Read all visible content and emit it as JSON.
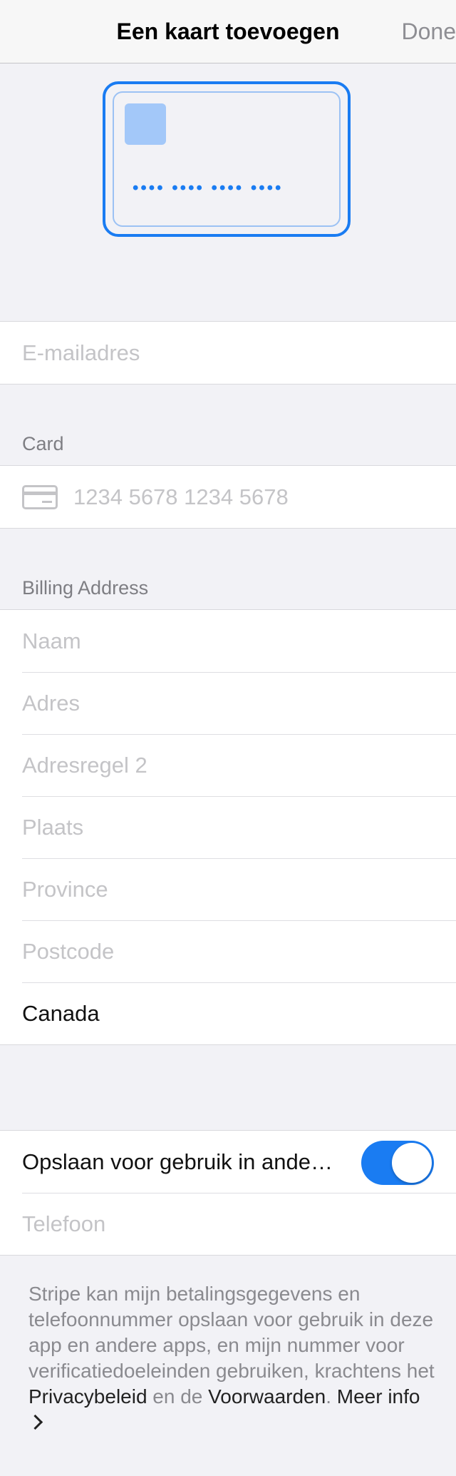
{
  "nav": {
    "title": "Een kaart toevoegen",
    "done": "Done"
  },
  "card_preview": {
    "dots": "•••• •••• •••• ••••"
  },
  "email": {
    "placeholder": "E-mailadres"
  },
  "card": {
    "header": "Card",
    "number_placeholder": "1234 5678 1234 5678"
  },
  "billing": {
    "header": "Billing Address",
    "name": "Naam",
    "address": "Adres",
    "address2": "Adresregel 2",
    "city": "Plaats",
    "province": "Province",
    "postcode": "Postcode",
    "country": "Canada"
  },
  "save": {
    "label": "Opslaan voor gebruik in ande…",
    "toggle_on": true,
    "phone_placeholder": "Telefoon"
  },
  "footer": {
    "text1": "Stripe kan mijn betalingsgegevens en telefoonnummer opslaan voor gebruik in deze app en andere apps, en mijn nummer voor verificatiedoeleinden gebruiken, krachtens het ",
    "privacy": "Privacybeleid",
    "text2": " en de ",
    "terms": "Voorwaarden",
    "text3": ". ",
    "more": "Meer info"
  },
  "colors": {
    "accent": "#1a7cf2",
    "background": "#f2f2f6"
  }
}
